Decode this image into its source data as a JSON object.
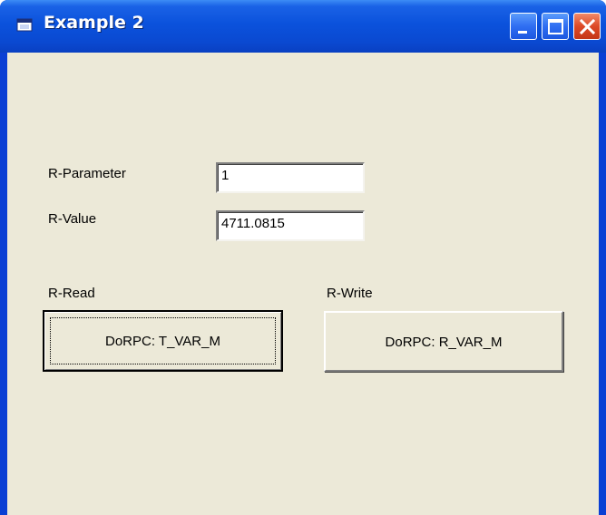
{
  "window": {
    "title": "Example 2"
  },
  "titlebar_buttons": {
    "minimize": "minimize-icon",
    "maximize": "maximize-icon",
    "close": "close-icon"
  },
  "form": {
    "r_parameter": {
      "label": "R-Parameter",
      "value": "1"
    },
    "r_value": {
      "label": "R-Value",
      "value": "4711.0815"
    },
    "read": {
      "label": "R-Read",
      "button": "DoRPC: T_VAR_M"
    },
    "write": {
      "label": "R-Write",
      "button": "DoRPC: R_VAR_M"
    }
  },
  "colors": {
    "titlebar": "#0a49d1",
    "client": "#ece9d8",
    "close_button": "#dd4a27"
  }
}
